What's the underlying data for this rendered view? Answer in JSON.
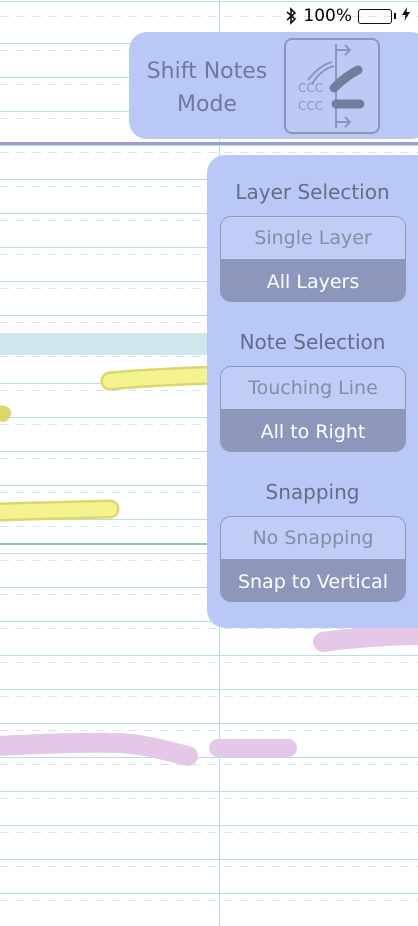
{
  "status_bar": {
    "bluetooth_icon": "bluetooth-icon",
    "battery_percent": "100%",
    "battery_level": 1.0,
    "battery_color": "#4cd964",
    "charging_icon": "bolt-icon"
  },
  "mode": {
    "title": "Shift Notes Mode",
    "icon": "shift-notes-icon"
  },
  "options": {
    "layer_selection": {
      "title": "Layer Selection",
      "options": [
        "Single Layer",
        "All Layers"
      ],
      "selected": "All Layers"
    },
    "note_selection": {
      "title": "Note Selection",
      "options": [
        "Touching Line",
        "All to Right"
      ],
      "selected": "All to Right"
    },
    "snapping": {
      "title": "Snapping",
      "options": [
        "No Snapping",
        "Snap to Vertical"
      ],
      "selected": "Snap to Vertical"
    }
  },
  "colors": {
    "panel": "#b9c8f7",
    "selected_segment": "#8d96bb",
    "highlight_yellow": "#f3f18a",
    "highlight_pink": "#e5c8e8",
    "rule_line": "#b9dde6",
    "divider": "#9b9fd6"
  }
}
